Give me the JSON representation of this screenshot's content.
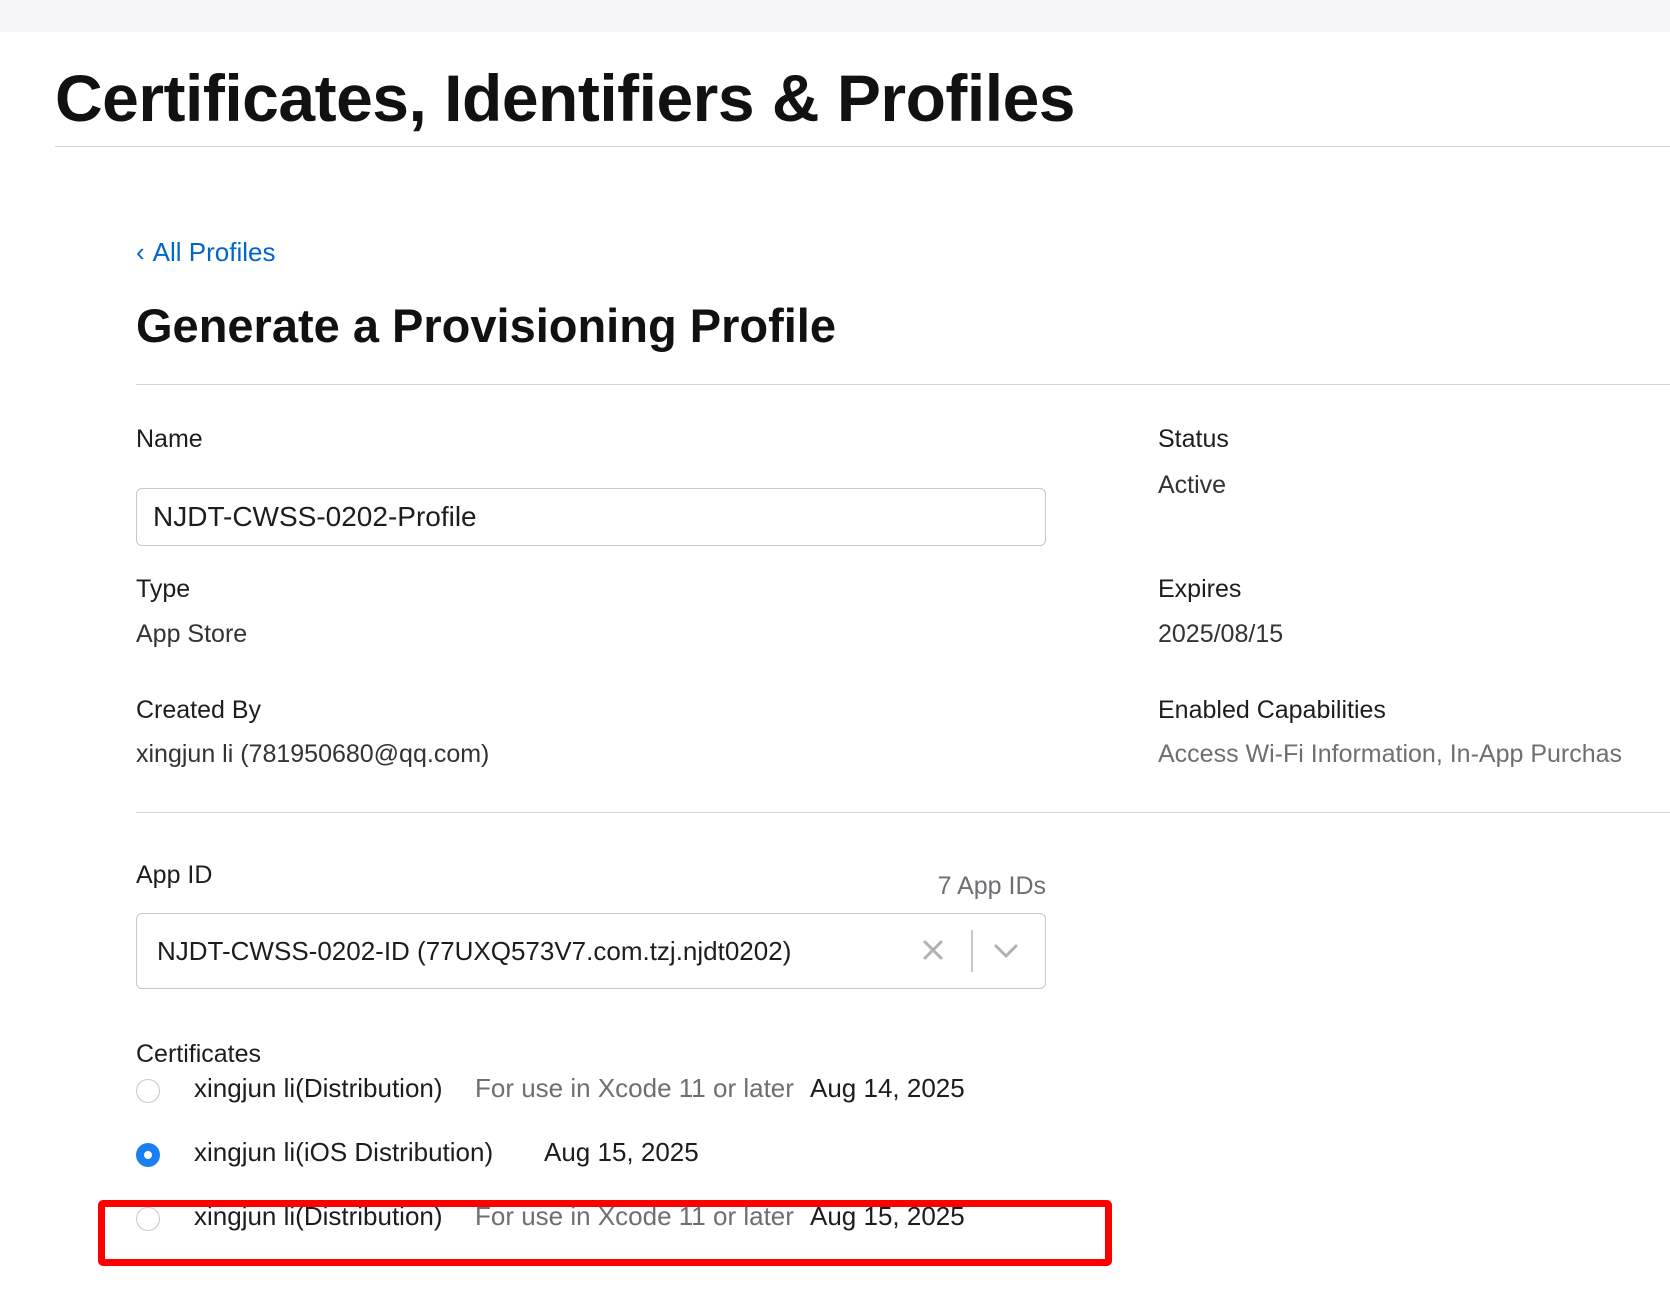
{
  "header": {
    "title": "Certificates, Identifiers & Profiles"
  },
  "nav": {
    "back_label": "All Profiles"
  },
  "form": {
    "title": "Generate a Provisioning Profile",
    "name": {
      "label": "Name",
      "value": "NJDT-CWSS-0202-Profile"
    },
    "status": {
      "label": "Status",
      "value": "Active"
    },
    "type": {
      "label": "Type",
      "value": "App Store"
    },
    "expires": {
      "label": "Expires",
      "value": "2025/08/15"
    },
    "created_by": {
      "label": "Created By",
      "value": "xingjun li (781950680@qq.com)"
    },
    "capabilities": {
      "label": "Enabled Capabilities",
      "value": "Access Wi-Fi Information, In-App Purchas"
    },
    "app_id": {
      "label": "App ID",
      "count": "7 App IDs",
      "selected": "NJDT-CWSS-0202-ID (77UXQ573V7.com.tzj.njdt0202)"
    },
    "certificates": {
      "label": "Certificates",
      "items": [
        {
          "name": "xingjun li(Distribution)",
          "note": "For use in Xcode 11 or later",
          "date": "Aug 14, 2025",
          "selected": false
        },
        {
          "name": "xingjun li(iOS Distribution)",
          "note": "",
          "date": "Aug 15, 2025",
          "selected": true
        },
        {
          "name": "xingjun li(Distribution)",
          "note": "For use in Xcode 11 or later",
          "date": "Aug 15, 2025",
          "selected": false
        }
      ]
    }
  },
  "colors": {
    "link": "#0066cc",
    "radio_selected": "#1a7ff0",
    "highlight": "#ff0000"
  },
  "icons": {
    "back": "chevron-left-icon",
    "clear": "close-icon",
    "dropdown": "chevron-down-icon"
  }
}
